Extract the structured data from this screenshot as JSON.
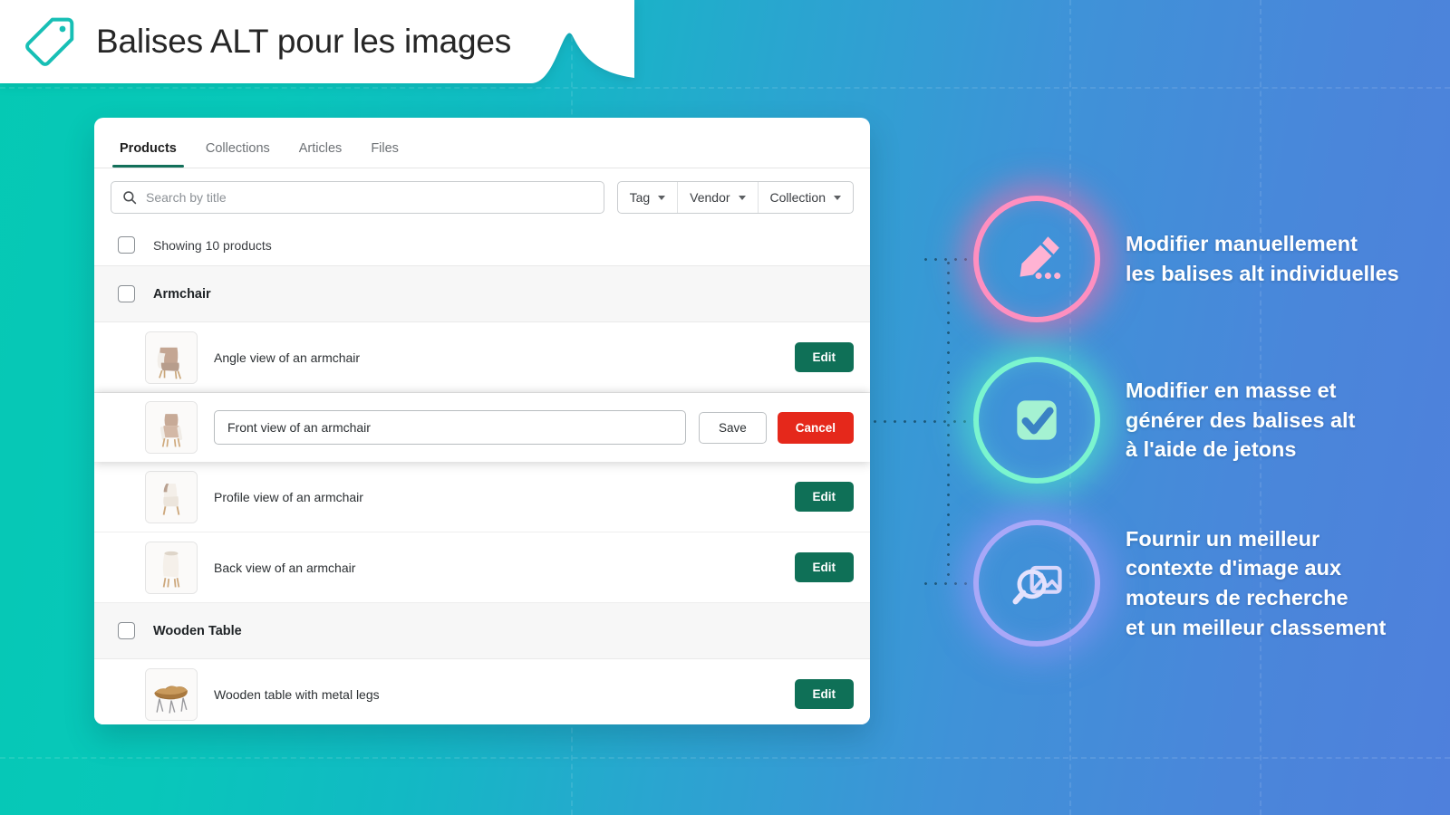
{
  "banner": {
    "title": "Balises ALT pour les images",
    "icon": "tag-icon"
  },
  "colors": {
    "bg_left": "#05c9b4",
    "bg_right": "#4f80dc",
    "tab_active_underline": "#13705a",
    "edit_button": "#0f7057",
    "cancel_button": "#e5281b",
    "callout_1_glow": "#ff8fc0",
    "callout_2_glow": "#7bf5cf",
    "callout_3_glow": "#a9a8f8"
  },
  "app": {
    "tabs": [
      {
        "label": "Products",
        "active": true
      },
      {
        "label": "Collections",
        "active": false
      },
      {
        "label": "Articles",
        "active": false
      },
      {
        "label": "Files",
        "active": false
      }
    ],
    "search": {
      "placeholder": "Search by title",
      "value": "",
      "icon": "search-icon"
    },
    "filters": [
      {
        "label": "Tag",
        "icon": "chevron-down-icon"
      },
      {
        "label": "Vendor",
        "icon": "chevron-down-icon"
      },
      {
        "label": "Collection",
        "icon": "chevron-down-icon"
      }
    ],
    "count_label": "Showing 10 products",
    "groups": [
      {
        "name": "Armchair",
        "images": [
          {
            "alt": "Angle view of an armchair",
            "thumb": "armchair-angle",
            "state": "view",
            "action": "Edit"
          },
          {
            "alt": "Front view of an armchair",
            "thumb": "armchair-front",
            "state": "editing",
            "save": "Save",
            "cancel": "Cancel"
          },
          {
            "alt": "Profile view of an armchair",
            "thumb": "armchair-profile",
            "state": "view",
            "action": "Edit"
          },
          {
            "alt": "Back view of an armchair",
            "thumb": "armchair-back",
            "state": "view",
            "action": "Edit"
          }
        ]
      },
      {
        "name": "Wooden Table",
        "images": [
          {
            "alt": "Wooden table with metal legs",
            "thumb": "wooden-table",
            "state": "view",
            "action": "Edit"
          }
        ]
      }
    ]
  },
  "callouts": [
    {
      "icon": "pencil-edit-icon",
      "text": "Modifier manuellement\nles balises alt individuelles"
    },
    {
      "icon": "checkbox-check-icon",
      "text": "Modifier en masse et\ngénérer des balises alt\nà l'aide de jetons"
    },
    {
      "icon": "image-search-icon",
      "text": "Fournir un meilleur\ncontexte d'image aux\nmoteurs de recherche\net un meilleur classement"
    }
  ]
}
